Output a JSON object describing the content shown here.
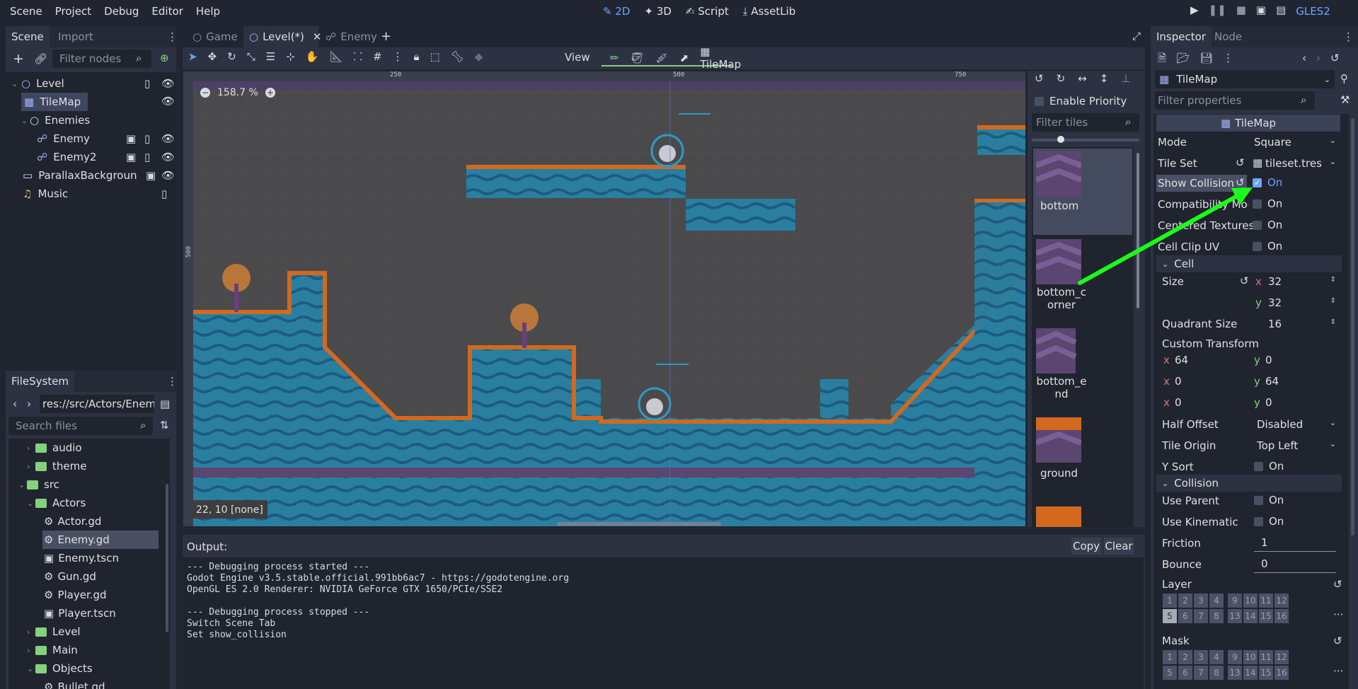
{
  "menu": {
    "items": [
      "Scene",
      "Project",
      "Debug",
      "Editor",
      "Help"
    ],
    "workspaces": [
      "2D",
      "3D",
      "Script",
      "AssetLib"
    ],
    "renderer": "GLES2"
  },
  "scene_dock": {
    "tabs": [
      "Scene",
      "Import"
    ],
    "filter_placeholder": "Filter nodes",
    "nodes": [
      {
        "label": "Level"
      },
      {
        "label": "TileMap"
      },
      {
        "label": "Enemies"
      },
      {
        "label": "Enemy"
      },
      {
        "label": "Enemy2"
      },
      {
        "label": "ParallaxBackgroun"
      },
      {
        "label": "Music"
      }
    ]
  },
  "filesystem": {
    "tab": "FileSystem",
    "path": "res://src/Actors/Enem",
    "search_placeholder": "Search files",
    "items": [
      {
        "label": "audio"
      },
      {
        "label": "theme"
      },
      {
        "label": "src"
      },
      {
        "label": "Actors"
      },
      {
        "label": "Actor.gd"
      },
      {
        "label": "Enemy.gd"
      },
      {
        "label": "Enemy.tscn"
      },
      {
        "label": "Gun.gd"
      },
      {
        "label": "Player.gd"
      },
      {
        "label": "Player.tscn"
      },
      {
        "label": "Level"
      },
      {
        "label": "Main"
      },
      {
        "label": "Objects"
      },
      {
        "label": "Bullet.gd"
      }
    ]
  },
  "editor_tabs": [
    "Game",
    "Level(*)",
    "Enemy"
  ],
  "toolbar": {
    "view_label": "View",
    "tilemap_label": "TileMap"
  },
  "viewport": {
    "zoom": "158.7 %",
    "ruler_marks": [
      "250",
      "500",
      "750"
    ],
    "ruler_left_mark": "500",
    "cursor_status": "22, 10 [none]"
  },
  "tile_palette": {
    "enable_priority": "Enable Priority",
    "filter_placeholder": "Filter tiles",
    "tiles": [
      "bottom",
      "bottom_c\norner",
      "bottom_e\nnd",
      "ground"
    ]
  },
  "output": {
    "title": "Output:",
    "copy_label": "Copy",
    "clear_label": "Clear",
    "lines": [
      "--- Debugging process started ---",
      "Godot Engine v3.5.stable.official.991bb6ac7 - https://godotengine.org",
      "OpenGL ES 2.0 Renderer: NVIDIA GeForce GTX 1650/PCIe/SSE2",
      "",
      "--- Debugging process stopped ---",
      "Switch Scene Tab",
      "Set show_collision"
    ]
  },
  "inspector": {
    "tabs": [
      "Inspector",
      "Node"
    ],
    "node_name": "TileMap",
    "filter_placeholder": "Filter properties",
    "section_title": "TileMap",
    "mode_label": "Mode",
    "mode_value": "Square",
    "tileset_label": "Tile Set",
    "tileset_value": "tileset.tres",
    "show_collision_label": "Show Collision",
    "show_collision_value": "On",
    "compat_label": "Compatibility Mod",
    "compat_value": "On",
    "centered_label": "Centered Textures",
    "centered_value": "On",
    "clipuv_label": "Cell Clip UV",
    "clipuv_value": "On",
    "cell_section": "Cell",
    "size_label": "Size",
    "size_x": "32",
    "size_y": "32",
    "quadrant_label": "Quadrant Size",
    "quadrant_value": "16",
    "custom_transform_label": "Custom Transform",
    "transform": [
      [
        "64",
        "0"
      ],
      [
        "0",
        "64"
      ],
      [
        "0",
        "0"
      ]
    ],
    "half_offset_label": "Half Offset",
    "half_offset_value": "Disabled",
    "tile_origin_label": "Tile Origin",
    "tile_origin_value": "Top Left",
    "ysort_label": "Y Sort",
    "ysort_value": "On",
    "collision_section": "Collision",
    "use_parent_label": "Use Parent",
    "use_parent_value": "On",
    "use_kinematic_label": "Use Kinematic",
    "use_kinematic_value": "On",
    "friction_label": "Friction",
    "friction_value": "1",
    "bounce_label": "Bounce",
    "bounce_value": "0",
    "layer_label": "Layer",
    "mask_label": "Mask",
    "bits_row1": [
      "1",
      "2",
      "3",
      "4",
      "9",
      "10",
      "11",
      "12"
    ],
    "bits_row2": [
      "5",
      "6",
      "7",
      "8",
      "13",
      "14",
      "15",
      "16"
    ]
  },
  "colors": {
    "accent": "#6aa5ff",
    "annotation_arrow": "#1aff1a",
    "active_workspace": "#6aa5ff"
  }
}
